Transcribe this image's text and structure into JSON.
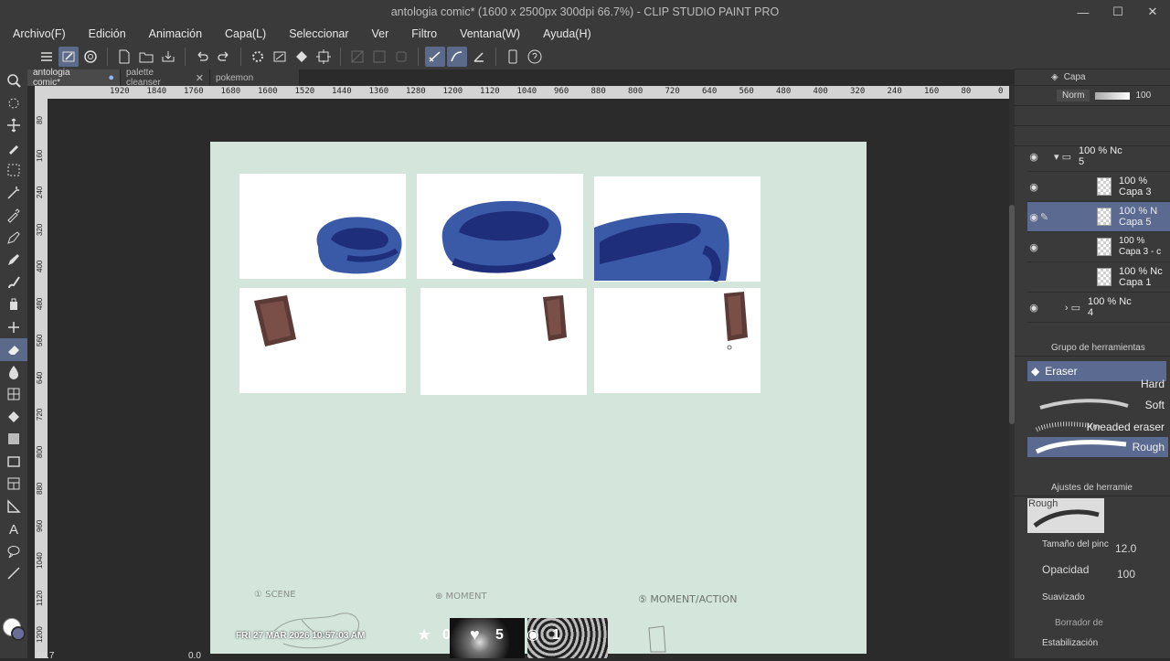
{
  "window": {
    "title": "antologia comic* (1600 x 2500px 300dpi 66.7%)  - CLIP STUDIO PAINT PRO"
  },
  "menu": [
    "Archivo(F)",
    "Edición",
    "Animación",
    "Capa(L)",
    "Seleccionar",
    "Ver",
    "Filtro",
    "Ventana(W)",
    "Ayuda(H)"
  ],
  "tabs": [
    {
      "label": "antologia comic*"
    },
    {
      "label": "palette cleanser"
    },
    {
      "label": "pokemon"
    }
  ],
  "ruler": [
    "1920",
    "1840",
    "1760",
    "1680",
    "1600",
    "1520",
    "1440",
    "1360",
    "1280",
    "1200",
    "1120",
    "1040",
    "960",
    "880",
    "800",
    "720",
    "640",
    "560",
    "480",
    "400",
    "320",
    "240",
    "160",
    "80",
    "0",
    "80",
    "160",
    "240"
  ],
  "vruler": [
    "80",
    "160",
    "240",
    "320",
    "400",
    "480",
    "560",
    "640",
    "720",
    "800",
    "880",
    "960",
    "1040",
    "1120",
    "1200"
  ],
  "layers_panel": {
    "title": "Capa",
    "blend": "Norm",
    "opacity": "100",
    "layers": [
      {
        "pct": "100 %",
        "mode": "Nc",
        "name": "5"
      },
      {
        "pct": "100 %",
        "mode": "",
        "name": "Capa 3"
      },
      {
        "pct": "100 %",
        "mode": "N",
        "name": "Capa 5"
      },
      {
        "pct": "100 %",
        "mode": "",
        "name": "Capa 3 - c"
      },
      {
        "pct": "100 %",
        "mode": "Nc",
        "name": "Capa 1"
      },
      {
        "pct": "100 %",
        "mode": "Nc",
        "name": "4"
      }
    ]
  },
  "tool_group": {
    "title": "Grupo de herramientas",
    "active": "Eraser",
    "brushes": [
      "Hard",
      "Soft",
      "Kneaded eraser",
      "Rough"
    ]
  },
  "tool_settings": {
    "title": "Ajustes de herramie",
    "preset": "Rough",
    "size_label": "Tamaño del pinc",
    "size": "12.0",
    "opacity_label": "Opacidad",
    "opacity": "100",
    "smooth_label": "Suavizado",
    "eraser_label": "Borrador de",
    "stab_label": "Estabilización"
  },
  "overlay": {
    "date": "FRI 27 MAR 2026 10:57:03 AM",
    "stars": "0",
    "hearts": "5",
    "views": "1"
  },
  "sketch_labels": [
    "① SCENE",
    "⊕ MOMENT",
    "⑤ MOMENT/ACTION"
  ],
  "status": {
    "zoom": "66.7",
    "coords": "0.0"
  }
}
